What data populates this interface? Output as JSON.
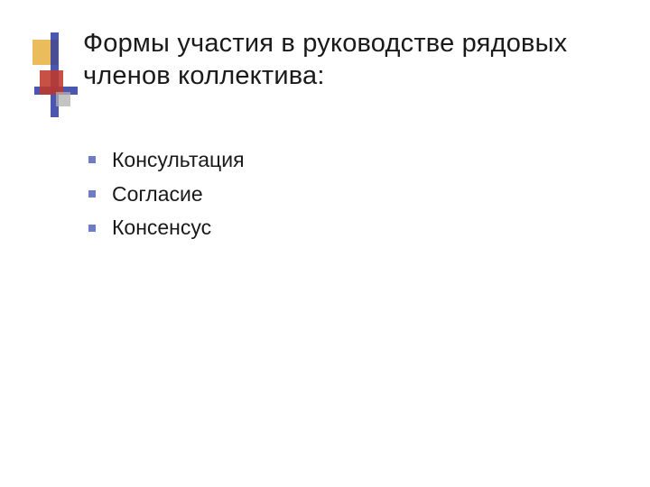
{
  "title": "Формы участия в руководстве рядовых членов коллектива:",
  "bullets": [
    "Консультация",
    "Согласие",
    "Консенсус"
  ]
}
